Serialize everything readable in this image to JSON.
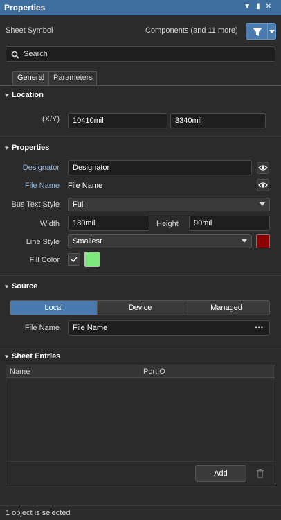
{
  "titlebar": {
    "title": "Properties"
  },
  "header": {
    "object_type": "Sheet Symbol",
    "filter_text": "Components (and 11 more)"
  },
  "search": {
    "placeholder": "Search"
  },
  "tabs": [
    {
      "label": "General"
    },
    {
      "label": "Parameters"
    }
  ],
  "location": {
    "section_title": "Location",
    "xy_label": "(X/Y)",
    "x_value": "10410mil",
    "y_value": "3340mil"
  },
  "properties": {
    "section_title": "Properties",
    "designator_label": "Designator",
    "designator_value": "Designator",
    "filename_label": "File Name",
    "filename_value": "File Name",
    "bus_text_style_label": "Bus Text Style",
    "bus_text_style_value": "Full",
    "width_label": "Width",
    "width_value": "180mil",
    "height_label": "Height",
    "height_value": "90mil",
    "line_style_label": "Line Style",
    "line_style_value": "Smallest",
    "line_color": "#8b0000",
    "fill_color_label": "Fill Color",
    "fill_color": "#7ee87e",
    "fill_checked": true
  },
  "source": {
    "section_title": "Source",
    "segments": [
      {
        "label": "Local"
      },
      {
        "label": "Device"
      },
      {
        "label": "Managed"
      }
    ],
    "filename_label": "File Name",
    "filename_value": "File Name",
    "more_label": "•••"
  },
  "sheet_entries": {
    "section_title": "Sheet Entries",
    "columns": [
      {
        "label": "Name"
      },
      {
        "label": "PortIO"
      }
    ],
    "add_label": "Add"
  },
  "status": {
    "text": "1 object is selected"
  },
  "colors": {
    "accent": "#3e6f9e",
    "segment_active": "#4a7bb0",
    "label_blue": "#8fb7e0"
  }
}
